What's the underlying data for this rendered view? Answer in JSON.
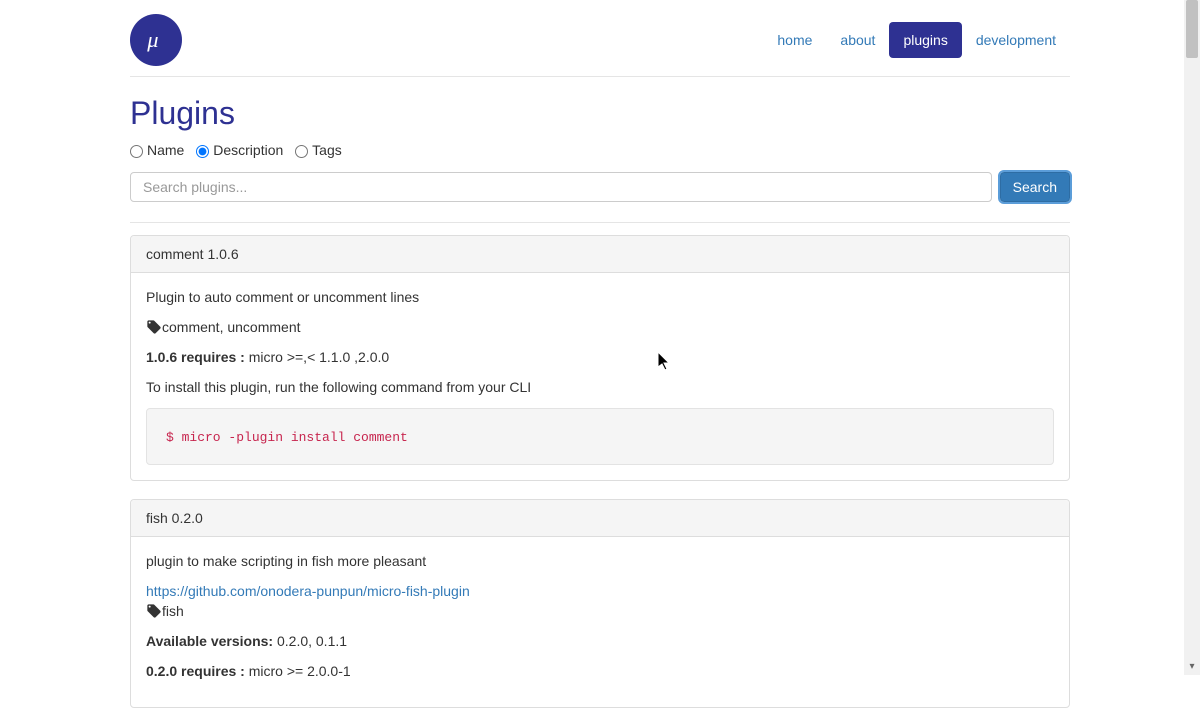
{
  "nav": {
    "home": "home",
    "about": "about",
    "plugins": "plugins",
    "development": "development"
  },
  "page_title": "Plugins",
  "search": {
    "options": {
      "name": "Name",
      "description": "Description",
      "tags": "Tags",
      "selected": "description"
    },
    "placeholder": "Search plugins...",
    "button": "Search"
  },
  "plugins": [
    {
      "title": "comment 1.0.6",
      "description": "Plugin to auto comment or uncomment lines",
      "tags": "comment, uncomment",
      "requires_label": "1.0.6 requires :",
      "requires_value": " micro >=,< 1.1.0 ,2.0.0",
      "install_text": "To install this plugin, run the following command from your CLI",
      "install_cmd": "$ micro -plugin install comment"
    },
    {
      "title": "fish 0.2.0",
      "description": "plugin to make scripting in fish more pleasant",
      "link": "https://github.com/onodera-punpun/micro-fish-plugin",
      "tags": "fish",
      "available_label": "Available versions:",
      "available_value": " 0.2.0, 0.1.1",
      "requires_label": "0.2.0 requires :",
      "requires_value": " micro >= 2.0.0-1"
    }
  ]
}
